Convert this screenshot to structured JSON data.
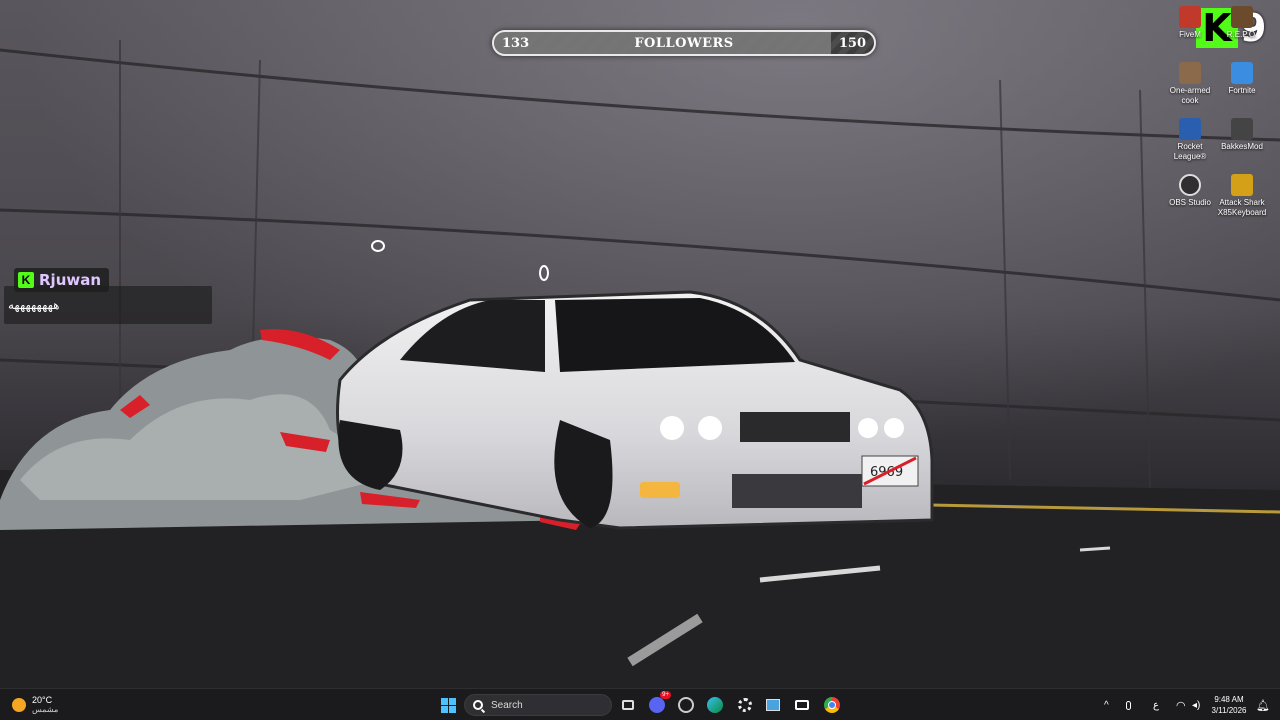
{
  "followers_goal": {
    "current": "133",
    "label": "FOLLOWERS",
    "target": "150",
    "progress_fraction": 0.887
  },
  "kick_overlay": {
    "logo_letter": "K",
    "logo_number": "9",
    "accent_color": "#53fc18"
  },
  "chat": {
    "badge": "K",
    "username": "Rjuwan",
    "message": "ههههههههه"
  },
  "desktop_icons": [
    {
      "label": "FiveM",
      "icon": "fivem-icon",
      "color": "#c0392b"
    },
    {
      "label": "R.E.P.O.",
      "icon": "repo-icon",
      "color": "#6b4b2b"
    },
    {
      "label": "One-armed cook",
      "icon": "cook-icon",
      "color": "#8a6a4a"
    },
    {
      "label": "Fortnite",
      "icon": "fortnite-icon",
      "color": "#3a8de0"
    },
    {
      "label": "Rocket League®",
      "icon": "rocket-league-icon",
      "color": "#2a5fb0"
    },
    {
      "label": "BakkesMod",
      "icon": "bakkesmod-icon",
      "color": "#444444"
    },
    {
      "label": "OBS Studio",
      "icon": "obs-icon",
      "color": "#302e31"
    },
    {
      "label": "Attack Shark X85Keyboard",
      "icon": "keyboard-icon",
      "color": "#d4a017"
    }
  ],
  "taskbar": {
    "weather_temp": "20°C",
    "weather_desc": "مشمس",
    "search_placeholder": "Search",
    "discord_badge": "9+",
    "keyboard_lang": "ع",
    "time": "9:48 AM",
    "date": "3/11/2026"
  }
}
